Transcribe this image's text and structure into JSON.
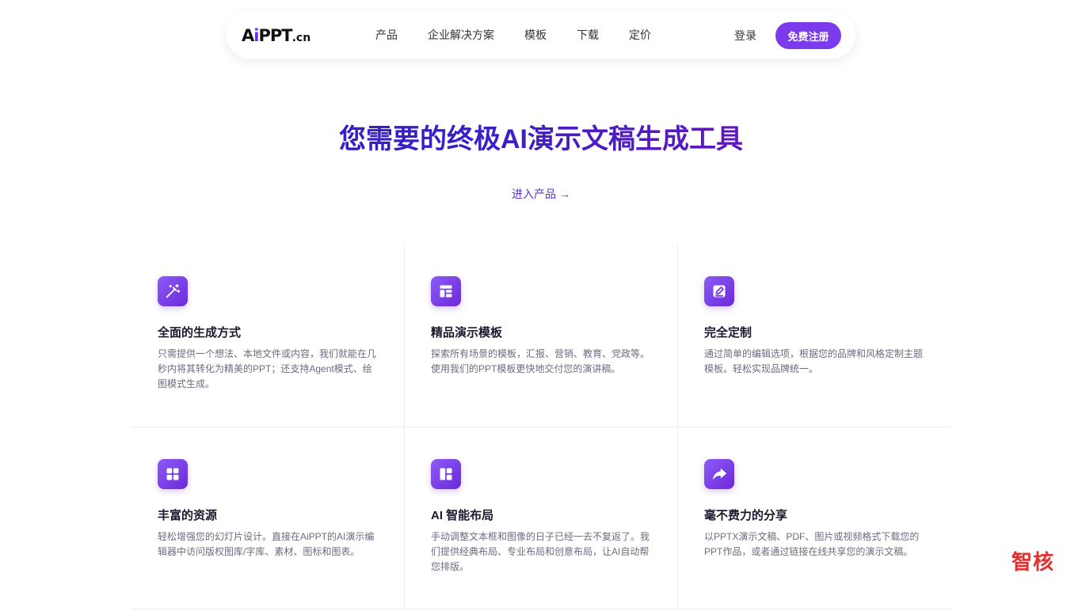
{
  "nav": {
    "logo": {
      "a": "A",
      "i": "i",
      "ppt": "PPT",
      "cn": ".cn"
    },
    "links": [
      "产品",
      "企业解决方案",
      "模板",
      "下载",
      "定价"
    ],
    "login_label": "登录",
    "signup_label": "免费注册"
  },
  "hero": {
    "title": "您需要的终极AI演示文稿生成工具",
    "cta_label": "进入产品",
    "cta_arrow": "→"
  },
  "features": [
    {
      "icon": "magic-wand-icon",
      "title": "全面的生成方式",
      "description": "只需提供一个想法、本地文件或内容，我们就能在几秒内将其转化为精美的PPT；还支持Agent模式、绘图模式生成。"
    },
    {
      "icon": "template-layout-icon",
      "title": "精品演示模板",
      "description": "探索所有场景的模板，汇报、营销、教育、党政等。使用我们的PPT模板更快地交付您的演讲稿。"
    },
    {
      "icon": "edit-icon",
      "title": "完全定制",
      "description": "通过简单的编辑选项，根据您的品牌和风格定制主题模板。轻松实现品牌统一。"
    },
    {
      "icon": "resources-grid-icon",
      "title": "丰富的资源",
      "description": "轻松增强您的幻灯片设计。直接在AiPPT的AI演示编辑器中访问版权图库/字库、素材、图标和图表。"
    },
    {
      "icon": "smart-layout-icon",
      "title": "AI 智能布局",
      "description": "手动调整文本框和图像的日子已经一去不复返了。我们提供经典布局、专业布局和创意布局，让AI自动帮您排版。"
    },
    {
      "icon": "share-icon",
      "title": "毫不费力的分享",
      "description": "以PPTX演示文稿、PDF、图片或视频格式下载您的PPT作品，或者通过链接在线共享您的演示文稿。"
    }
  ],
  "watermark": "智核",
  "colors": {
    "accent": "#7c3aed",
    "title_gradient_start": "#2a1bb8",
    "title_gradient_end": "#8a138f",
    "watermark": "#e03030"
  }
}
